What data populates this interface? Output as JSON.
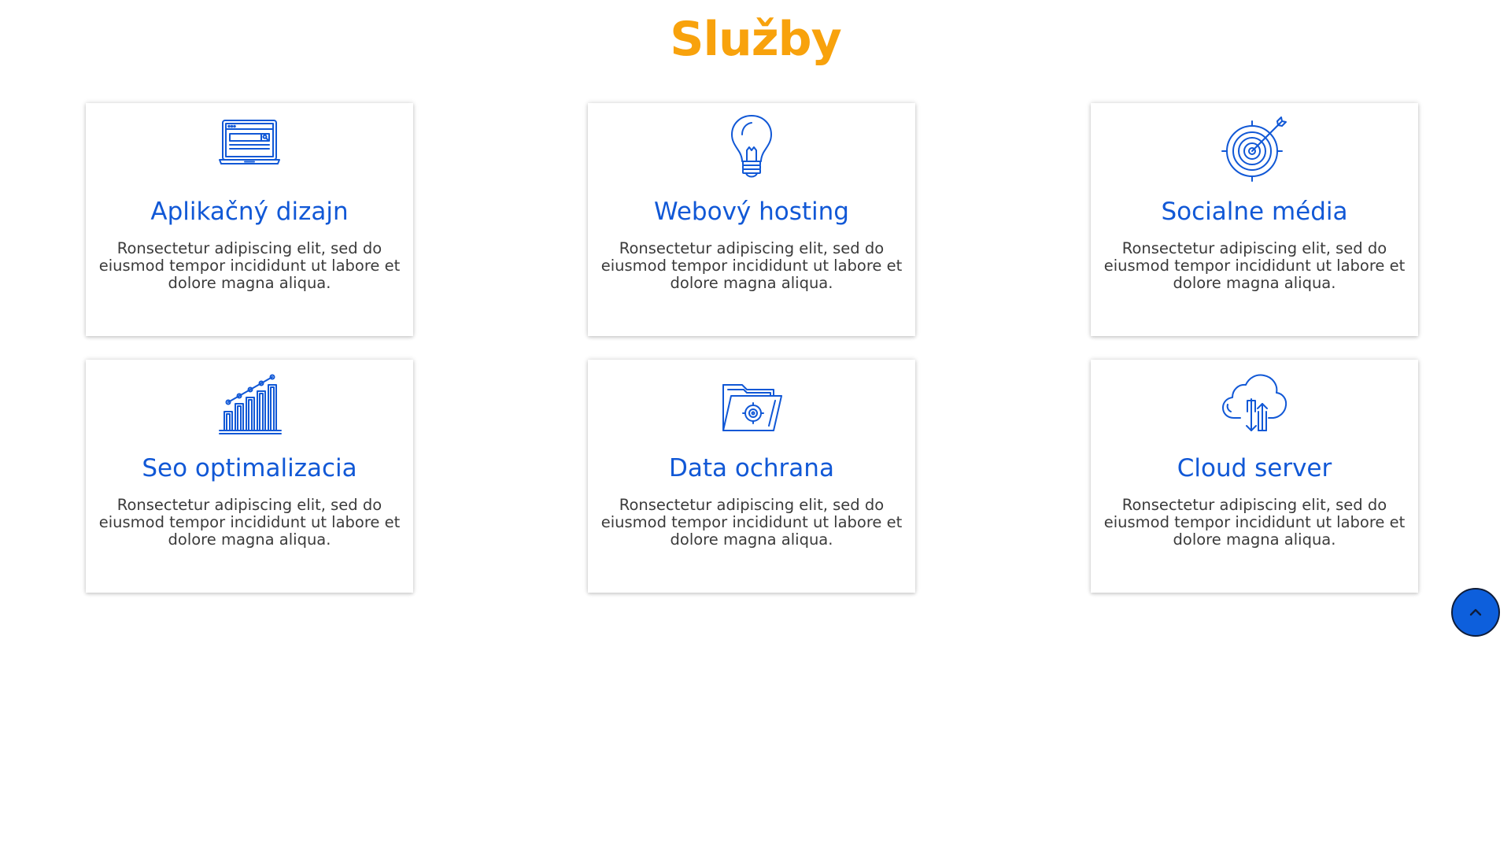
{
  "section": {
    "title": "Služby"
  },
  "colors": {
    "title": "#f8a20c",
    "accent": "#1158d6",
    "text": "#3b3b3b",
    "button": "#0d5fdc"
  },
  "services": [
    {
      "icon": "laptop-browser-icon",
      "title": "Aplikačný dizajn",
      "text": "Ronsectetur adipiscing elit, sed do eiusmod tempor incididunt ut labore et dolore magna aliqua."
    },
    {
      "icon": "lightbulb-icon",
      "title": "Webový hosting",
      "text": "Ronsectetur adipiscing elit, sed do eiusmod tempor incididunt ut labore et dolore magna aliqua."
    },
    {
      "icon": "target-arrow-icon",
      "title": "Socialne média",
      "text": "Ronsectetur adipiscing elit, sed do eiusmod tempor incididunt ut labore et dolore magna aliqua."
    },
    {
      "icon": "bar-chart-growth-icon",
      "title": "Seo optimalizacia",
      "text": "Ronsectetur adipiscing elit, sed do eiusmod tempor incididunt ut labore et dolore magna aliqua."
    },
    {
      "icon": "folder-target-icon",
      "title": "Data ochrana",
      "text": "Ronsectetur adipiscing elit, sed do eiusmod tempor incididunt ut labore et dolore magna aliqua."
    },
    {
      "icon": "cloud-upload-download-icon",
      "title": "Cloud server",
      "text": "Ronsectetur adipiscing elit, sed do eiusmod tempor incididunt ut labore et dolore magna aliqua."
    }
  ],
  "scroll_top": {
    "icon": "chevron-up-icon"
  }
}
